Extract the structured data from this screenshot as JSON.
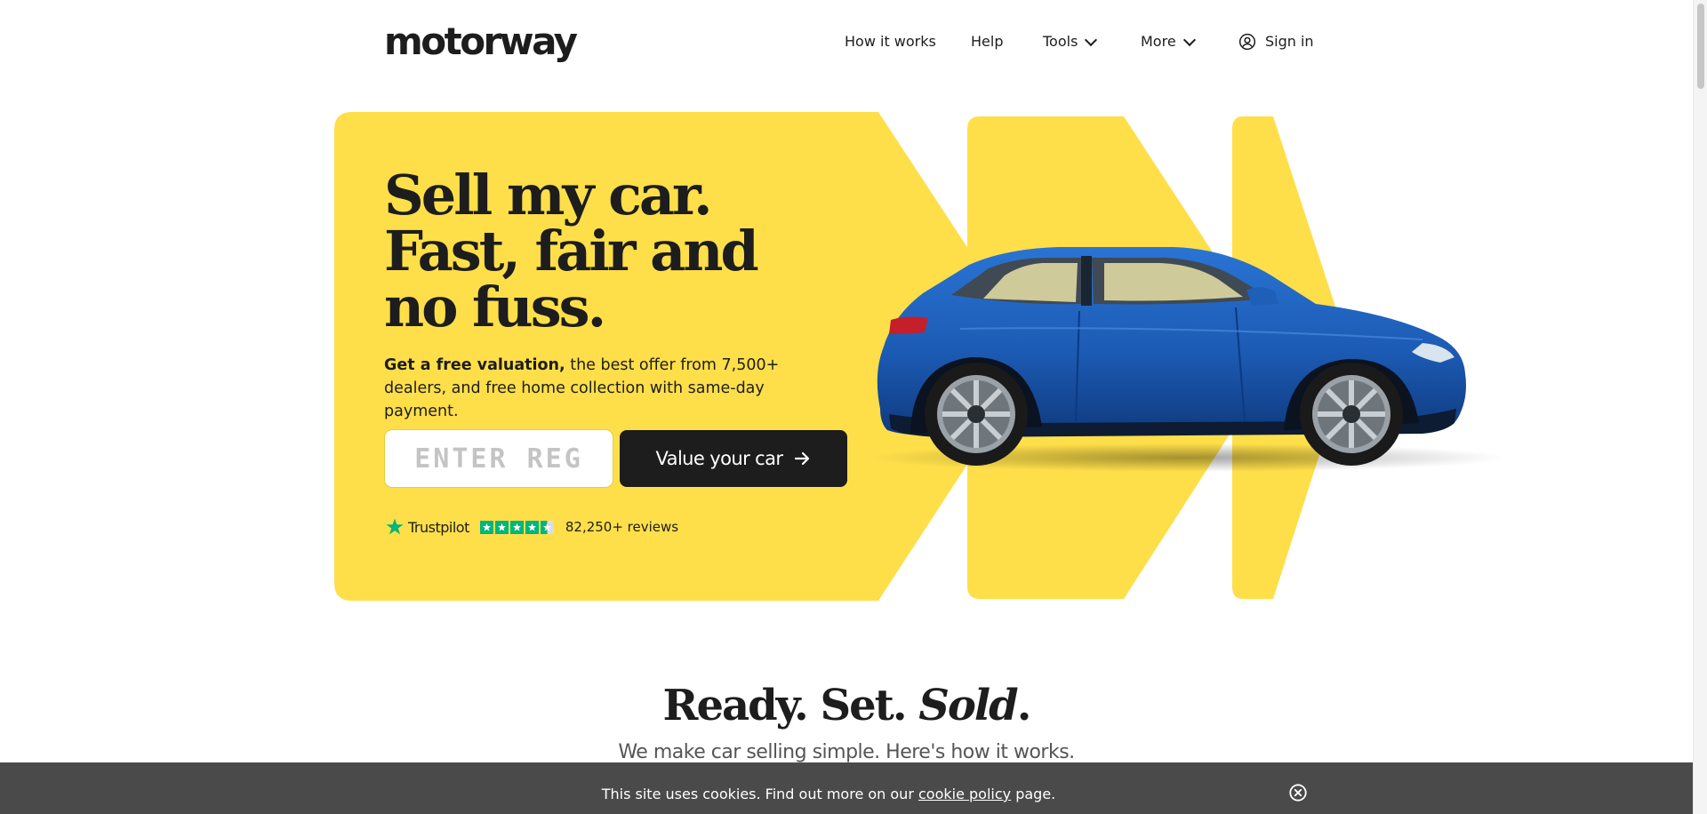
{
  "header": {
    "logo": "motorway",
    "nav": {
      "how_it_works": "How it works",
      "help": "Help",
      "tools": "Tools",
      "more": "More",
      "sign_in": "Sign in"
    }
  },
  "hero": {
    "headline": [
      "Sell my car.",
      "Fast, fair and",
      "no fuss."
    ],
    "subtext_bold": "Get a free valuation,",
    "subtext_rest": " the best offer from 7,500+ dealers, and free home collection with same-day payment.",
    "reg_placeholder": "ENTER REG",
    "cta_label": "Value your car",
    "trustpilot": {
      "name": "Trustpilot",
      "rating_stars": 4.5,
      "reviews": "82,250+ reviews"
    }
  },
  "section": {
    "title_plain": "Ready. Set. ",
    "title_italic": "Sold",
    "title_end": ".",
    "subtitle": "We make car selling simple. Here's how it works."
  },
  "cookie": {
    "text_before": "This site uses cookies. Find out more on our ",
    "link": "cookie policy",
    "text_after": " page."
  },
  "colors": {
    "brand_yellow": "#fedf4a",
    "ink": "#1d1d1d",
    "trustpilot_green": "#00b67a",
    "cookie_bg": "#4a4a4a",
    "car_blue": "#1e5fb8"
  }
}
